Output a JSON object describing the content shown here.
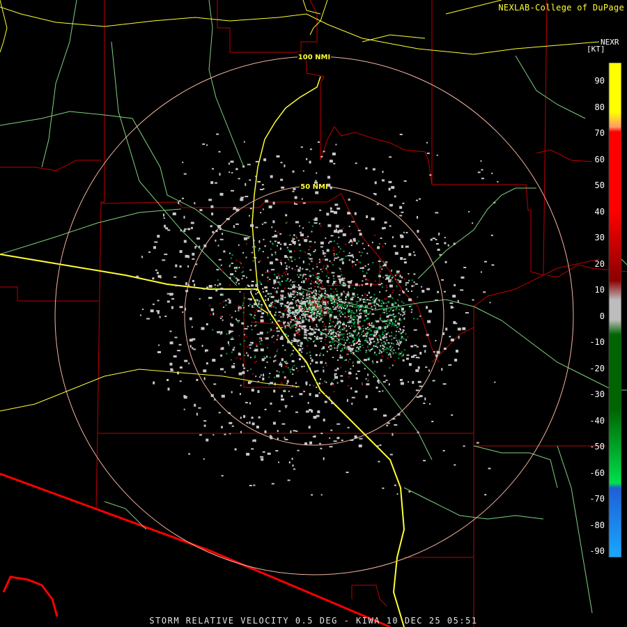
{
  "credit": "NEXLAB-College of DuPage",
  "legend": {
    "title": "NEXR",
    "unit": "[KT]",
    "labels": [
      "90",
      "80",
      "70",
      "60",
      "50",
      "40",
      "30",
      "20",
      "10",
      "0",
      "-10",
      "-20",
      "-30",
      "-40",
      "-50",
      "-60",
      "-70",
      "-80",
      "-90"
    ],
    "colors": {
      "top": "#ffff00",
      "orange": "#ff9966",
      "red": "#ff0000",
      "darkred": "#8b0000",
      "gray": "#bdbdbd",
      "darkgreen": "#006400",
      "green": "#00e04c",
      "blue": "#1e5fd6",
      "lightblue": "#19a8ff"
    }
  },
  "range_rings": [
    {
      "label": "100 NMI"
    },
    {
      "label": "50 NMI"
    }
  ],
  "footer": "STORM RELATIVE VELOCITY 0.5 DEG - KIWA 10 DEC 25 05:51",
  "colors": {
    "county_lines": "#c00000",
    "highways": "#ffff33",
    "roads": "#7fd27f",
    "ring": "#f4b6a0",
    "border": "#ff0000",
    "echo_gray": "#c8c8c8",
    "echo_green": "#00a040",
    "echo_red": "#b00000"
  }
}
